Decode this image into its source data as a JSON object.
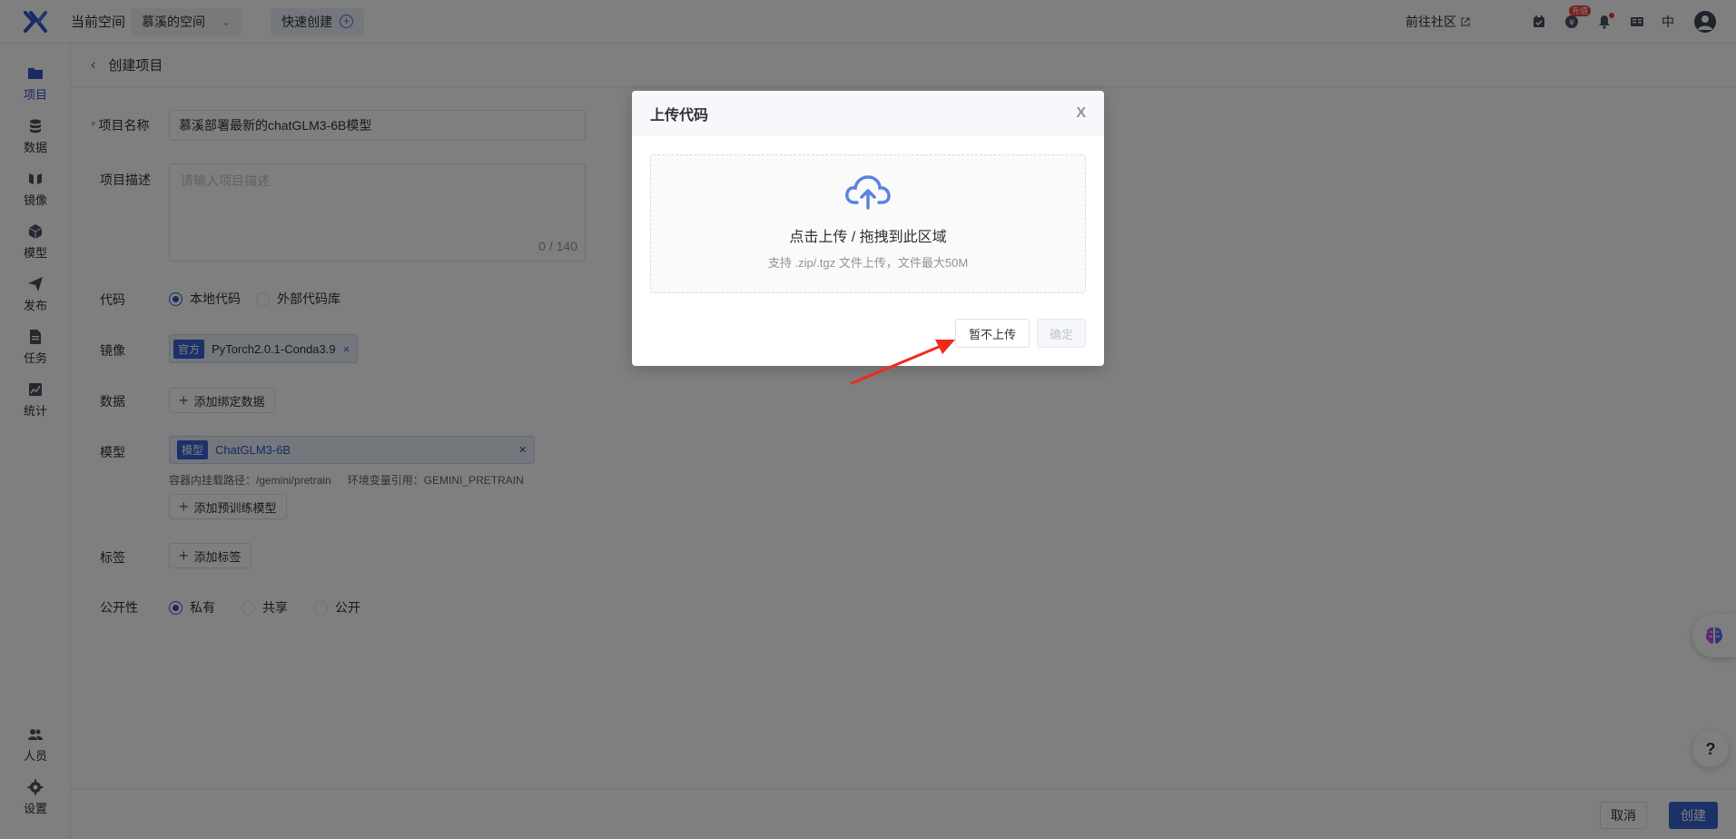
{
  "topbar": {
    "current_space_label": "当前空间",
    "space_name": "慕溪的空间",
    "quick_create_label": "快速创建",
    "community_link": "前往社区",
    "recharge_badge": "充值",
    "lang": "中"
  },
  "sidebar": {
    "items": [
      {
        "label": "项目",
        "icon": "folder-icon",
        "active": true
      },
      {
        "label": "数据",
        "icon": "database-icon"
      },
      {
        "label": "镜像",
        "icon": "mirror-icon"
      },
      {
        "label": "模型",
        "icon": "cube-icon"
      },
      {
        "label": "发布",
        "icon": "send-icon"
      },
      {
        "label": "任务",
        "icon": "task-icon"
      },
      {
        "label": "统计",
        "icon": "chart-icon"
      },
      {
        "label": "人员",
        "icon": "people-icon"
      },
      {
        "label": "设置",
        "icon": "gear-icon"
      }
    ]
  },
  "page": {
    "title": "创建项目"
  },
  "form": {
    "name_label": "项目名称",
    "required_mark": "*",
    "name_value": "慕溪部署最新的chatGLM3-6B模型",
    "desc_label": "项目描述",
    "desc_placeholder": "请输入项目描述",
    "desc_count": "0 / 140",
    "code_label": "代码",
    "code_options": [
      "本地代码",
      "外部代码库"
    ],
    "code_selected": "本地代码",
    "image_label": "镜像",
    "image_badge": "官方",
    "image_value": "PyTorch2.0.1-Conda3.9",
    "data_label": "数据",
    "add_data_button": "添加绑定数据",
    "model_label": "模型",
    "model_badge": "模型",
    "model_value": "ChatGLM3-6B",
    "model_mount_path": "容器内挂载路径：/gemini/pretrain",
    "model_env_var": "环境变量引用：GEMINI_PRETRAIN",
    "add_model_button": "添加预训练模型",
    "tag_label": "标签",
    "add_tag_button": "添加标签",
    "visibility_label": "公开性",
    "visibility_options": [
      "私有",
      "共享",
      "公开"
    ],
    "visibility_selected": "私有"
  },
  "footer": {
    "cancel": "取消",
    "create": "创建"
  },
  "dialog": {
    "title": "上传代码",
    "close": "X",
    "upload_main": "点击上传 / 拖拽到此区域",
    "upload_hint": "支持 .zip/.tgz 文件上传，文件最大50M",
    "skip_button": "暂不上传",
    "confirm_button": "确定"
  },
  "help": "?",
  "colors": {
    "primary": "#3a63d2",
    "annotation_arrow": "#f02a1e"
  }
}
